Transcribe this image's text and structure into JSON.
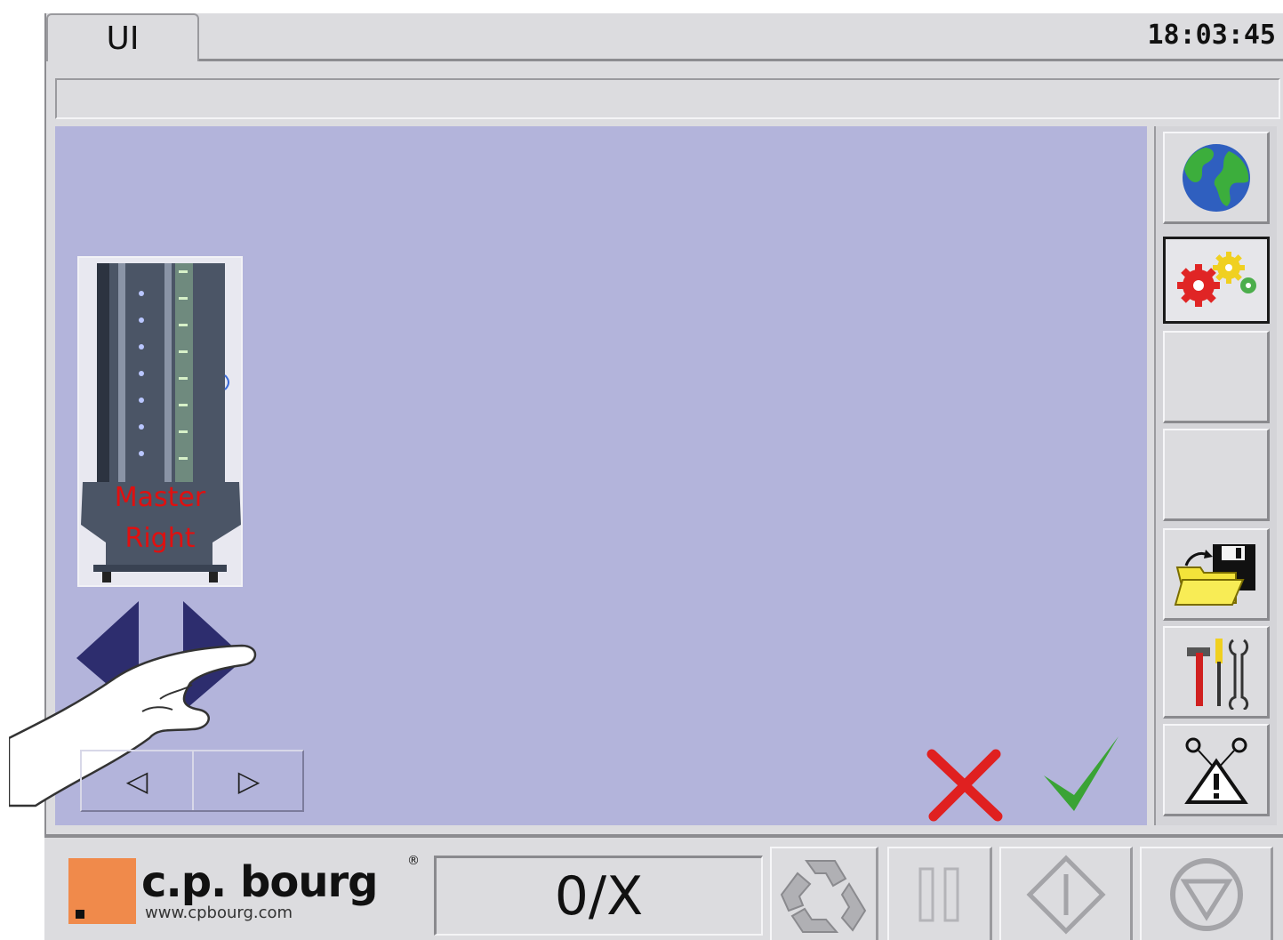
{
  "window": {
    "tab_label": "UI",
    "clock": "18:03:45",
    "message": ""
  },
  "machine_panel": {
    "line1": "Master",
    "line2": "Right"
  },
  "nav": {
    "prev_glyph": "◁",
    "next_glyph": "▷"
  },
  "counter": {
    "value": "0/X"
  },
  "logo": {
    "brand": "c.p. bourg",
    "url": "www.cpbourg.com",
    "registered": "®"
  },
  "sidebar": {
    "items": [
      {
        "icon": "globe-icon"
      },
      {
        "icon": "gears-icon",
        "active": true
      },
      {
        "icon": ""
      },
      {
        "icon": ""
      },
      {
        "icon": "save-load-icon"
      },
      {
        "icon": "tools-icon"
      },
      {
        "icon": "warning-icon"
      }
    ]
  },
  "actions": {
    "cancel": "cancel-x-icon",
    "confirm": "confirm-check-icon"
  },
  "colors": {
    "work_area": "#b3b4db",
    "panel": "#dcdcdf",
    "logo_orange": "#f08a4b",
    "cancel": "#e02020",
    "confirm": "#3aa335"
  }
}
